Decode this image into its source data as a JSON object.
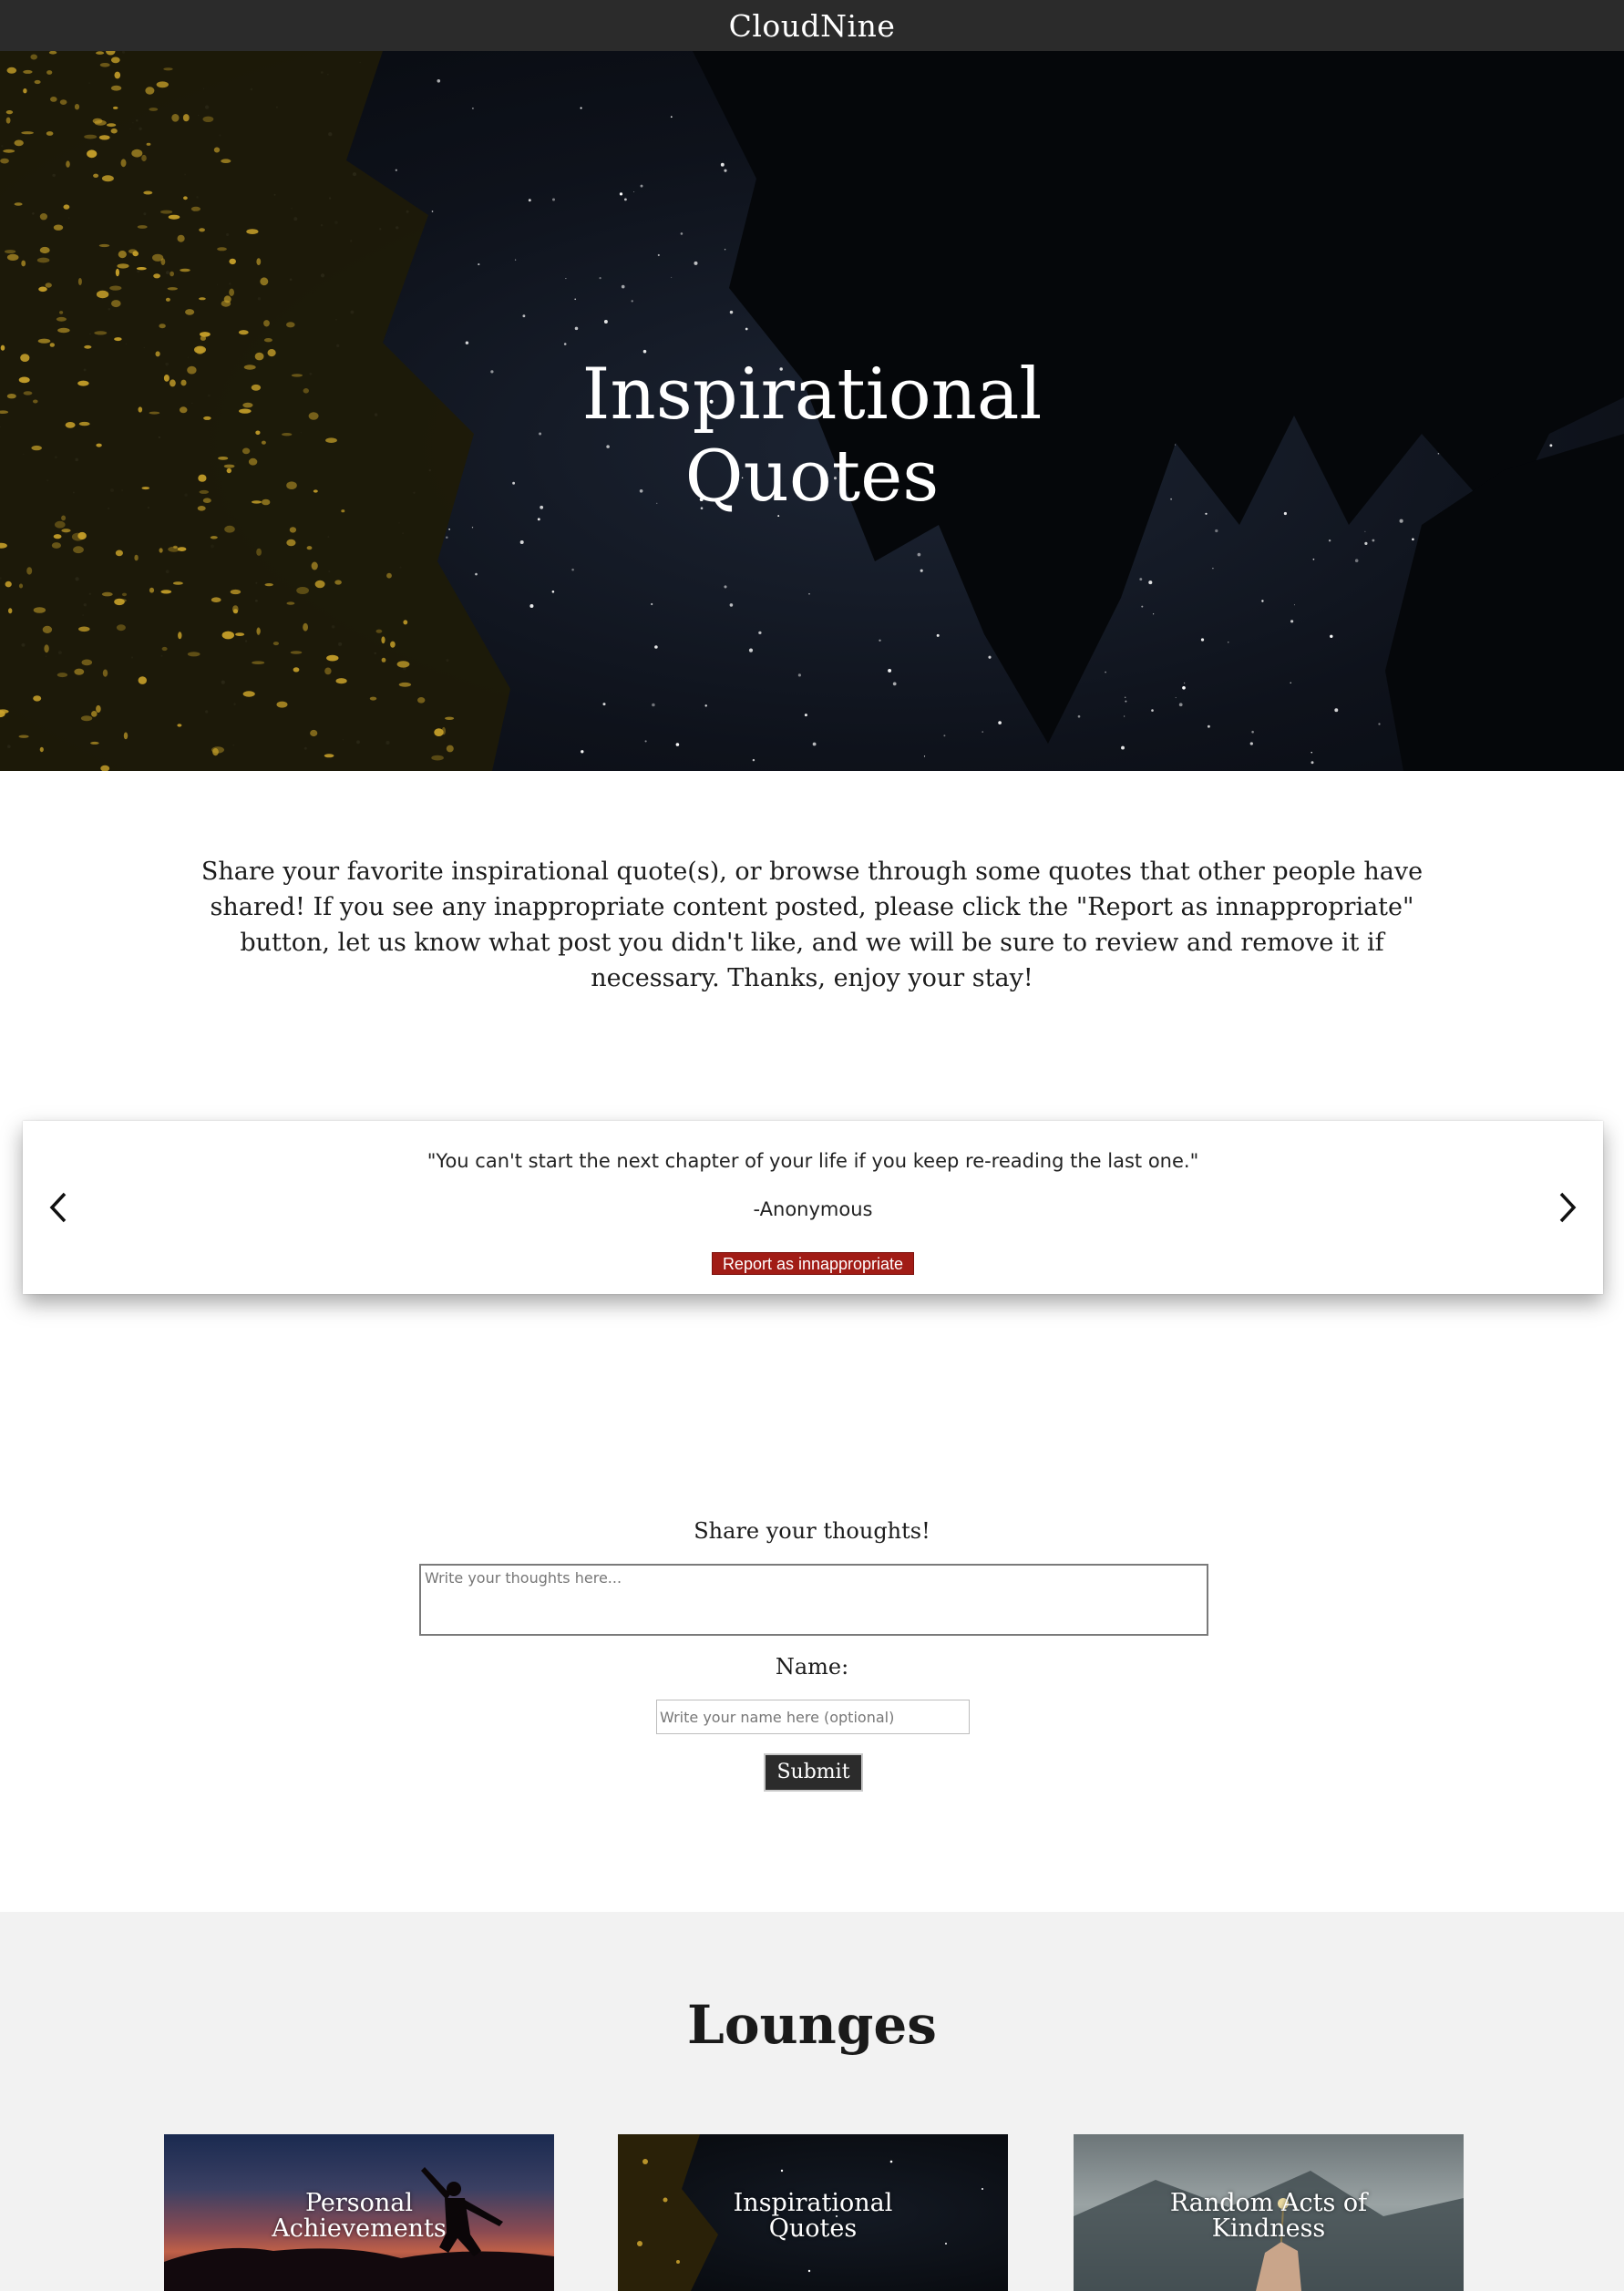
{
  "header": {
    "brand": "CloudNine"
  },
  "hero": {
    "title_line1": "Inspirational",
    "title_line2": "Quotes"
  },
  "intro": {
    "text": "Share your favorite inspirational quote(s), or browse through some quotes that other people have shared! If you see any inappropriate content posted, please click the \"Report as innappropriate\" button, let us know what post you didn't like, and we will be sure to review and remove it if necessary. Thanks, enjoy your stay!"
  },
  "carousel": {
    "quote": "\"You can't start the next chapter of your life if you keep re-reading the last one.\"",
    "author": "-Anonymous",
    "report_label": "Report as innappropriate",
    "prev_icon": "chevron-left-icon",
    "next_icon": "chevron-right-icon"
  },
  "form": {
    "title": "Share your thoughts!",
    "thoughts_placeholder": "Write your thoughts here...",
    "name_label": "Name:",
    "name_placeholder": "Write your name here (optional)",
    "submit_label": "Submit"
  },
  "lounges": {
    "title": "Lounges",
    "cards": [
      {
        "line1": "Personal",
        "line2": "Achievements"
      },
      {
        "line1": "Inspirational",
        "line2": "Quotes"
      },
      {
        "line1": "Random Acts of",
        "line2": "Kindness"
      }
    ]
  },
  "colors": {
    "topbar": "#2b2b2b",
    "report_button": "#a11c16",
    "submit_button": "#2b2b2b",
    "lounges_bg": "#f2f2f2"
  }
}
